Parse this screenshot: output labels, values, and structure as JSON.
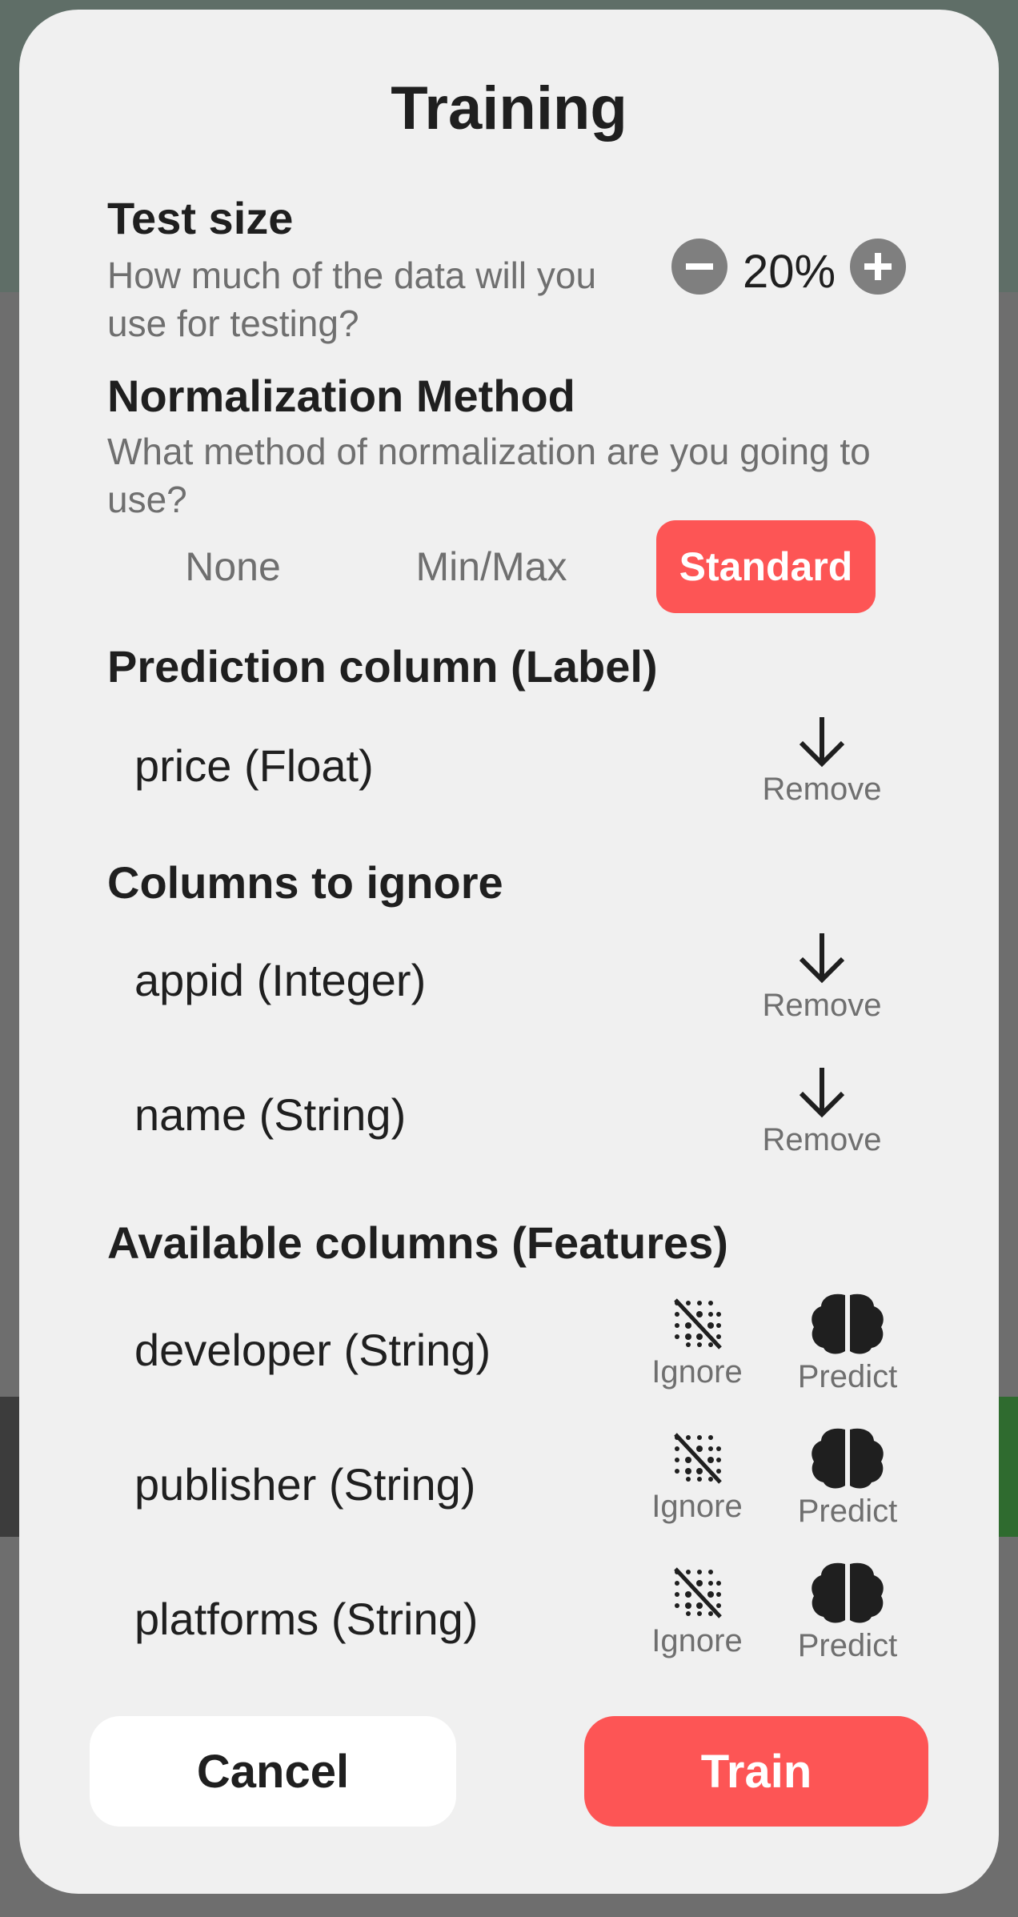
{
  "dialog": {
    "title": "Training"
  },
  "test_size": {
    "heading": "Test size",
    "description": "How much of the data will you use for testing?",
    "value": "20%",
    "decrement_icon": "minus-circle-icon",
    "increment_icon": "plus-circle-icon"
  },
  "normalization": {
    "heading": "Normalization Method",
    "description": "What method of normalization are you going to use?",
    "options": [
      "None",
      "Min/Max",
      "Standard"
    ],
    "selected": "Standard"
  },
  "prediction_column": {
    "heading": "Prediction column (Label)",
    "items": [
      {
        "label": "price (Float)",
        "action": "Remove",
        "icon": "arrow-down-icon"
      }
    ]
  },
  "ignore_columns": {
    "heading": "Columns to ignore",
    "items": [
      {
        "label": "appid (Integer)",
        "action": "Remove",
        "icon": "arrow-down-icon"
      },
      {
        "label": "name (String)",
        "action": "Remove",
        "icon": "arrow-down-icon"
      }
    ]
  },
  "available_columns": {
    "heading": "Available columns (Features)",
    "ignore_label": "Ignore",
    "predict_label": "Predict",
    "ignore_icon": "dots-slash-icon",
    "predict_icon": "brain-icon",
    "items": [
      {
        "label": "developer (String)"
      },
      {
        "label": "publisher (String)"
      },
      {
        "label": "platforms (String)"
      }
    ]
  },
  "footer": {
    "cancel_label": "Cancel",
    "train_label": "Train"
  },
  "colors": {
    "accent": "#fd5555",
    "modal_bg": "#f0f0f0",
    "text": "#1f1f1f",
    "muted": "#6f6f6f"
  }
}
